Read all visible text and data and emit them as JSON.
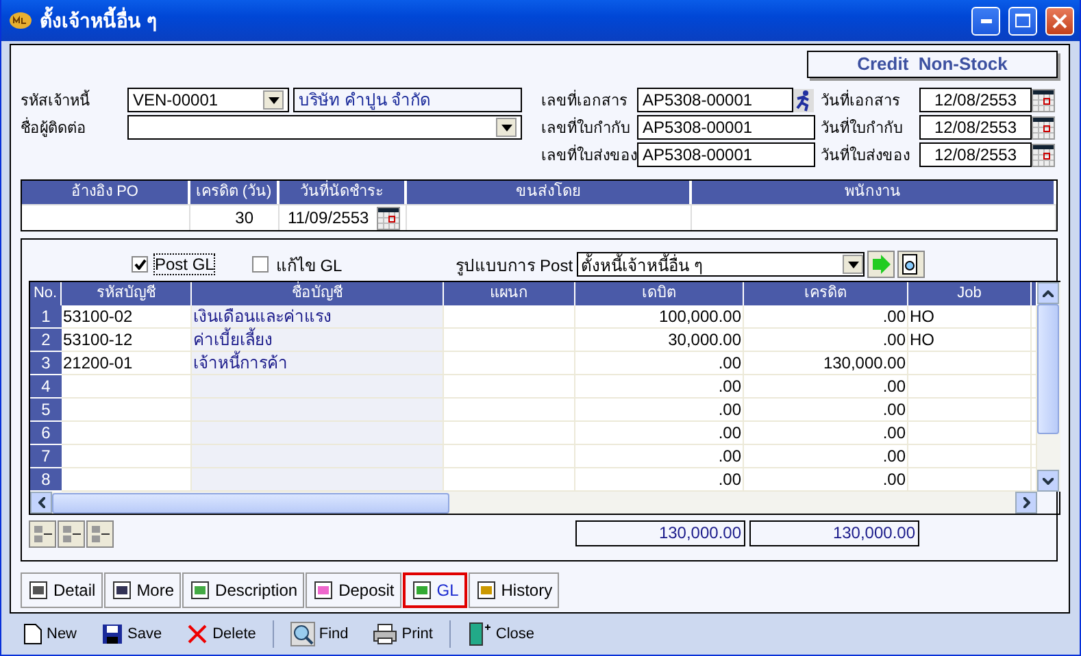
{
  "window": {
    "title": "ตั้งเจ้าหนี้อื่น ๆ"
  },
  "doc_type": "Credit  Non-Stock",
  "vendor": {
    "code_label": "รหัสเจ้าหนี้",
    "code": "VEN-00001",
    "name": "บริษัท คำปูน จำกัด",
    "contact_label": "ชื่อผู้ติดต่อ"
  },
  "doc_fields": [
    {
      "label": "เลขที่เอกสาร",
      "value": "AP5308-00001",
      "date_label": "วันที่เอกสาร",
      "date": "12/08/2553"
    },
    {
      "label": "เลขที่ใบกำกับ",
      "value": "AP5308-00001",
      "date_label": "วันที่ใบกำกับ",
      "date": "12/08/2553"
    },
    {
      "label": "เลขที่ใบส่งของ",
      "value": "AP5308-00001",
      "date_label": "วันที่ใบส่งของ",
      "date": "12/08/2553"
    }
  ],
  "header_table": {
    "columns": [
      "อ้างอิง PO",
      "เครดิต (วัน)",
      "วันที่นัดชำระ",
      "ขนส่งโดย",
      "พนักงาน"
    ],
    "credit_days": "30",
    "due_date": "11/09/2553"
  },
  "gl": {
    "post_gl": {
      "label": "Post GL",
      "checked": true
    },
    "edit_gl": {
      "label": "แก้ไข GL",
      "checked": false
    },
    "format_label": "รูปแบบการ Post",
    "format": "ตั้งหนี้เจ้าหนี้อื่น ๆ",
    "columns": [
      "No.",
      "รหัสบัญชี",
      "ชื่อบัญชี",
      "แผนก",
      "เดบิต",
      "เครดิต",
      "Job"
    ],
    "rows": [
      {
        "no": "1",
        "code": "53100-02",
        "name": "เงินเดือนและค่าแรง",
        "debit": "100,000.00",
        "credit": ".00",
        "job": "HO"
      },
      {
        "no": "2",
        "code": "53100-12",
        "name": "ค่าเบี้ยเลี้ยง",
        "debit": "30,000.00",
        "credit": ".00",
        "job": "HO"
      },
      {
        "no": "3",
        "code": "21200-01",
        "name": "เจ้าหนี้การค้า",
        "debit": ".00",
        "credit": "130,000.00",
        "job": ""
      },
      {
        "no": "4",
        "code": "",
        "name": "",
        "debit": ".00",
        "credit": ".00",
        "job": ""
      },
      {
        "no": "5",
        "code": "",
        "name": "",
        "debit": ".00",
        "credit": ".00",
        "job": ""
      },
      {
        "no": "6",
        "code": "",
        "name": "",
        "debit": ".00",
        "credit": ".00",
        "job": ""
      },
      {
        "no": "7",
        "code": "",
        "name": "",
        "debit": ".00",
        "credit": ".00",
        "job": ""
      },
      {
        "no": "8",
        "code": "",
        "name": "",
        "debit": ".00",
        "credit": ".00",
        "job": ""
      }
    ],
    "total_debit": "130,000.00",
    "total_credit": "130,000.00"
  },
  "tabs": [
    {
      "label": "Detail",
      "selected": false
    },
    {
      "label": "More",
      "selected": false
    },
    {
      "label": "Description",
      "selected": false
    },
    {
      "label": "Deposit",
      "selected": false
    },
    {
      "label": "GL",
      "selected": true
    },
    {
      "label": "History",
      "selected": false
    }
  ],
  "toolbar": [
    "New",
    "Save",
    "Delete",
    "Find",
    "Print",
    "Close"
  ]
}
